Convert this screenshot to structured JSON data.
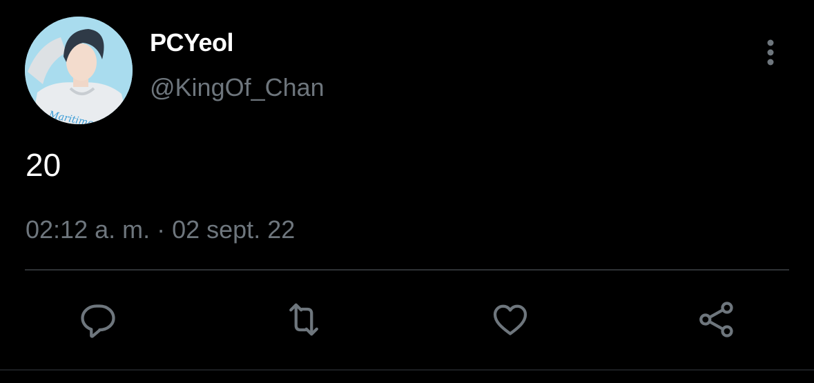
{
  "tweet": {
    "author": {
      "display_name": "PCYeol",
      "handle": "@KingOf_Chan"
    },
    "text": "20",
    "timestamp": "02:12 a. m. · 02 sept. 22"
  },
  "actions": [
    {
      "name": "reply",
      "icon": "reply-icon"
    },
    {
      "name": "retweet",
      "icon": "retweet-icon"
    },
    {
      "name": "like",
      "icon": "heart-icon"
    },
    {
      "name": "share",
      "icon": "share-icon"
    }
  ],
  "colors": {
    "background": "#000000",
    "primary_text": "#ffffff",
    "secondary_text": "#6e767d",
    "icon": "#6e767d",
    "divider": "#2f3336"
  }
}
